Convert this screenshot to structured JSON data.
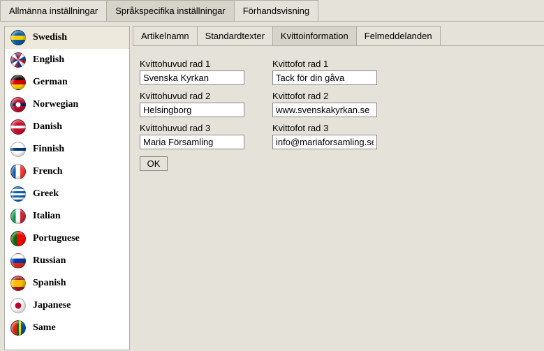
{
  "topTabs": [
    {
      "id": "general",
      "label": "Allmänna inställningar",
      "active": false
    },
    {
      "id": "langspec",
      "label": "Språkspecifika inställningar",
      "active": true
    },
    {
      "id": "preview",
      "label": "Förhandsvisning",
      "active": false
    }
  ],
  "languages": [
    {
      "id": "swedish",
      "label": "Swedish",
      "selected": true,
      "flagCss": "linear-gradient(to bottom,#0a5aa0 0 35%,#f9d100 35% 65%,#0a5aa0 65% 100%)"
    },
    {
      "id": "english",
      "label": "English",
      "selected": false,
      "flagCss": "repeating-conic-gradient(#b22234 0 30deg,#fff 30deg 60deg,#1b3e8b 60deg 90deg)"
    },
    {
      "id": "german",
      "label": "German",
      "selected": false,
      "flagCss": "linear-gradient(to bottom,#000 0 33%,#dd0000 33% 66%,#ffce00 66% 100%)"
    },
    {
      "id": "norwegian",
      "label": "Norwegian",
      "selected": false,
      "flagCss": "radial-gradient(circle,#fff 0 25%,transparent 25%),linear-gradient(to bottom,#ba0c2f 0 40%,#00205b 40% 60%,#ba0c2f 60% 100%)"
    },
    {
      "id": "danish",
      "label": "Danish",
      "selected": false,
      "flagCss": "linear-gradient(to bottom,#c8102e 0 40%,#fff 40% 60%,#c8102e 60% 100%)"
    },
    {
      "id": "finnish",
      "label": "Finnish",
      "selected": false,
      "flagCss": "linear-gradient(to bottom,#fff 0 40%,#003580 40% 60%,#fff 60% 100%)"
    },
    {
      "id": "french",
      "label": "French",
      "selected": false,
      "flagCss": "linear-gradient(to right,#0055a4 0 33%,#fff 33% 66%,#ef4135 66% 100%)"
    },
    {
      "id": "greek",
      "label": "Greek",
      "selected": false,
      "flagCss": "repeating-linear-gradient(to bottom,#0d5eaf 0 3px,#fff 3px 6px)"
    },
    {
      "id": "italian",
      "label": "Italian",
      "selected": false,
      "flagCss": "linear-gradient(to right,#009246 0 33%,#fff 33% 66%,#ce2b37 66% 100%)"
    },
    {
      "id": "portuguese",
      "label": "Portuguese",
      "selected": false,
      "flagCss": "linear-gradient(to right,#006600 0 40%,#ff0000 40% 100%)"
    },
    {
      "id": "russian",
      "label": "Russian",
      "selected": false,
      "flagCss": "linear-gradient(to bottom,#fff 0 33%,#0039a6 33% 66%,#d52b1e 66% 100%)"
    },
    {
      "id": "spanish",
      "label": "Spanish",
      "selected": false,
      "flagCss": "linear-gradient(to bottom,#aa151b 0 25%,#f1bf00 25% 75%,#aa151b 75% 100%)"
    },
    {
      "id": "japanese",
      "label": "Japanese",
      "selected": false,
      "flagCss": "radial-gradient(circle at 50% 50%,#bc002d 0 30%,#fff 32% 100%)"
    },
    {
      "id": "same",
      "label": "Same",
      "selected": false,
      "flagCss": "linear-gradient(to right,#d81e05 0 40%,#007229 40% 55%,#ffd500 55% 70%,#0057a3 70% 100%)"
    }
  ],
  "subTabs": [
    {
      "id": "articles",
      "label": "Artikelnamn",
      "active": false
    },
    {
      "id": "stdtext",
      "label": "Standardtexter",
      "active": false
    },
    {
      "id": "receipt",
      "label": "Kvittoinformation",
      "active": true
    },
    {
      "id": "errors",
      "label": "Felmeddelanden",
      "active": false
    }
  ],
  "form": {
    "head1_label": "Kvittohuvud rad 1",
    "head1_value": "Svenska Kyrkan",
    "head2_label": "Kvittohuvud rad 2",
    "head2_value": "Helsingborg",
    "head3_label": "Kvittohuvud rad 3",
    "head3_value": "Maria Församling",
    "foot1_label": "Kvittofot rad 1",
    "foot1_value": "Tack för din gåva",
    "foot2_label": "Kvittofot rad 2",
    "foot2_value": "www.svenskakyrkan.se",
    "foot3_label": "Kvittofot rad 3",
    "foot3_value": "info@mariaforsamling.se",
    "ok_label": "OK"
  }
}
